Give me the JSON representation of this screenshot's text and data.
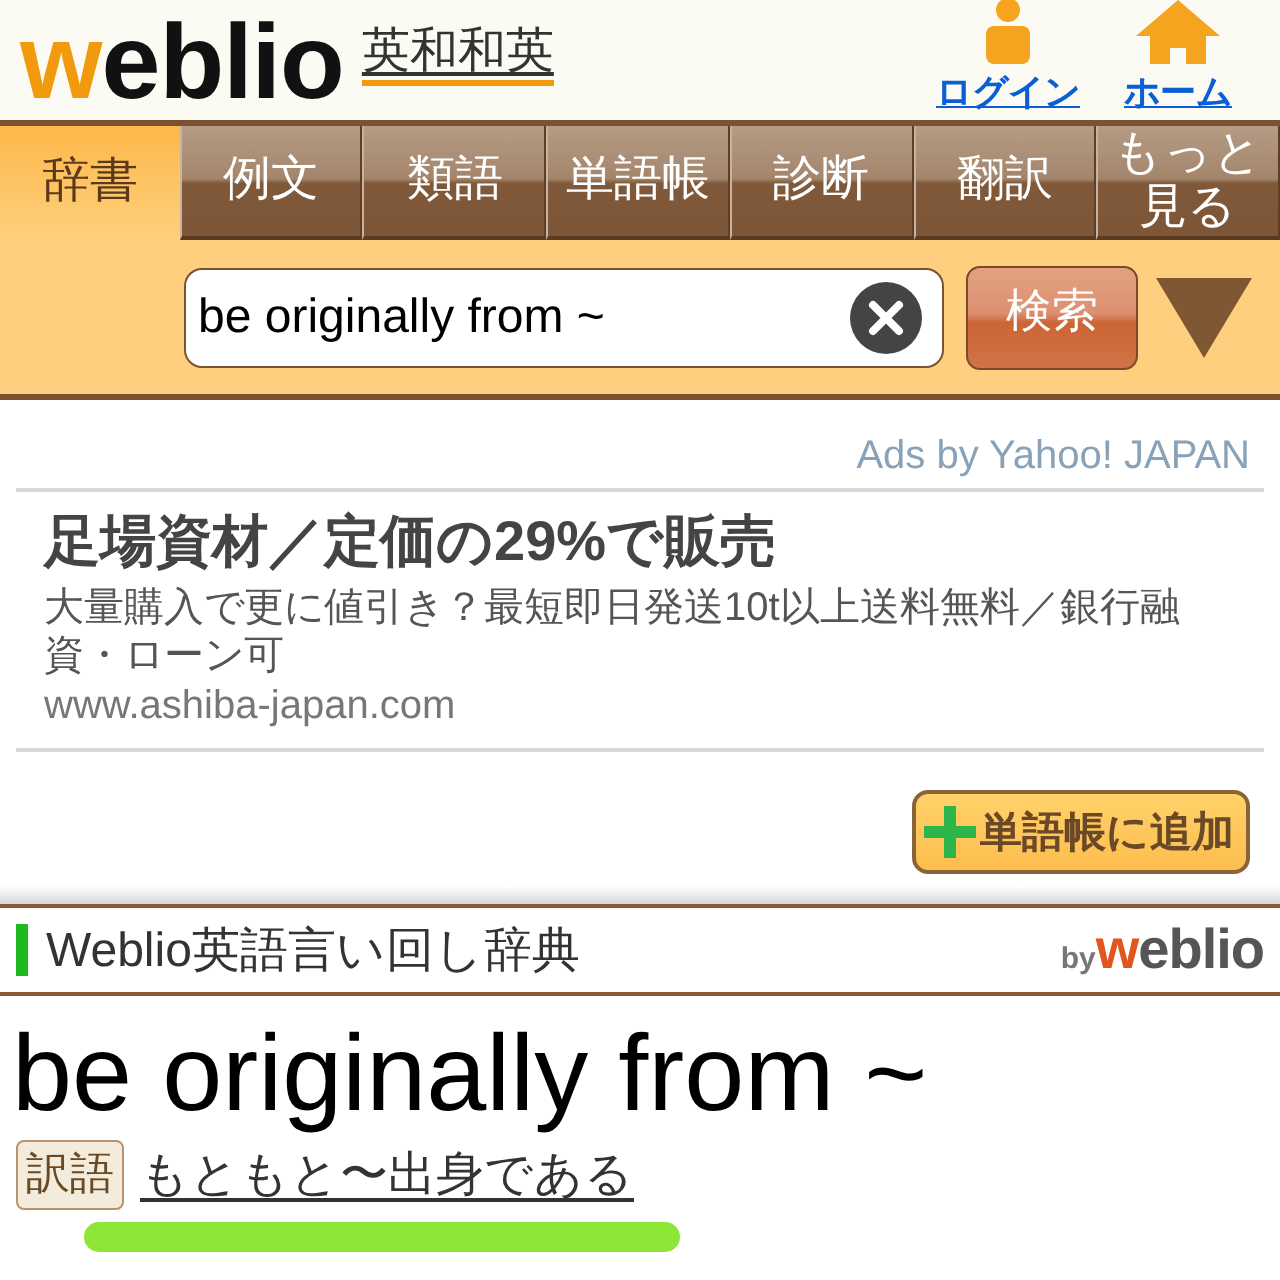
{
  "header": {
    "logo": "weblio",
    "dictionary_link": "英和和英",
    "nav_links": [
      {
        "kind": "login",
        "label": "ログイン"
      },
      {
        "kind": "home",
        "label": "ホーム"
      }
    ]
  },
  "tabs": [
    {
      "label": "辞書",
      "selected": true
    },
    {
      "label": "例文",
      "selected": false
    },
    {
      "label": "類語",
      "selected": false
    },
    {
      "label": "単語帳",
      "selected": false
    },
    {
      "label": "診断",
      "selected": false
    },
    {
      "label": "翻訳",
      "selected": false
    },
    {
      "label": "もっと見る",
      "selected": false
    }
  ],
  "search": {
    "value": "be originally from ~",
    "button": "検索"
  },
  "ad": {
    "attribution": "Ads by Yahoo! JAPAN",
    "title": "足場資材／定価の29%で販売",
    "description": "大量購入で更に値引き？最短即日発送10t以上送料無料／銀行融資・ローン可",
    "url": "www.ashiba-japan.com"
  },
  "add_button": "単語帳に追加",
  "section": {
    "title": "Weblio英語言い回し辞典",
    "by": "by",
    "logo": "weblio"
  },
  "entry": {
    "headword": "be originally from ~",
    "tag": "訳語",
    "translation": "もともと〜出身である"
  }
}
